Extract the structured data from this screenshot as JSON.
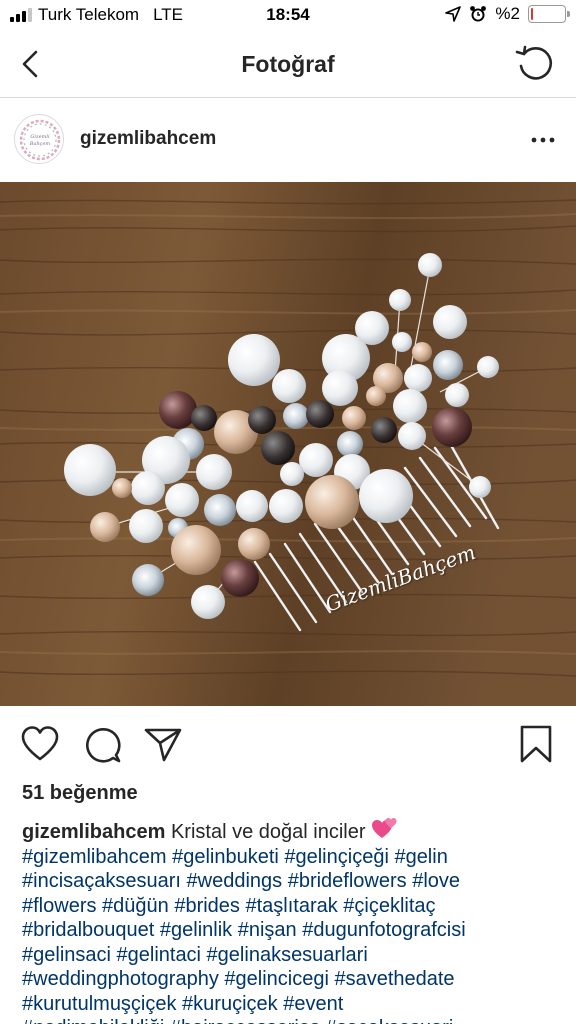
{
  "status": {
    "carrier": "Turk Telekom",
    "network": "LTE",
    "time": "18:54",
    "battery_text": "%2",
    "battery_level": 0.02,
    "battery_color": "#e8322d"
  },
  "nav": {
    "title": "Fotoğraf",
    "back_icon": "chevron-left-icon",
    "refresh_icon": "refresh-icon"
  },
  "post": {
    "username": "gizemlibahcem",
    "avatar_lines": [
      "Gizemli",
      "Bahçem"
    ],
    "photo_watermark": "GizemliBahçem",
    "likes": "51 beğenme",
    "caption_user": "gizemlibahcem",
    "caption_text": "Kristal ve doğal inciler",
    "caption_emoji": "two-hearts-icon",
    "hashtag_lines": [
      "#gizemlibahcem #gelinbuketi #gelinçiçeği #gelin",
      "#incisaçaksesuarı #weddings #brideflowers #love",
      "#flowers #düğün #brides #taşlıtarak #çiçeklitaç",
      "#bridalbouquet #gelinlik #nişan #dugunfotografcisi",
      "#gelinsaci #gelintaci #gelinaksesuarlari",
      "#weddingphotography #gelincicegi #savethedate",
      "#kurutulmuşçiçek #kuruçiçek #event",
      "#nedimebilekliği #hairaccessories #saçaksesuari"
    ],
    "hashtag_color": "#003569"
  }
}
